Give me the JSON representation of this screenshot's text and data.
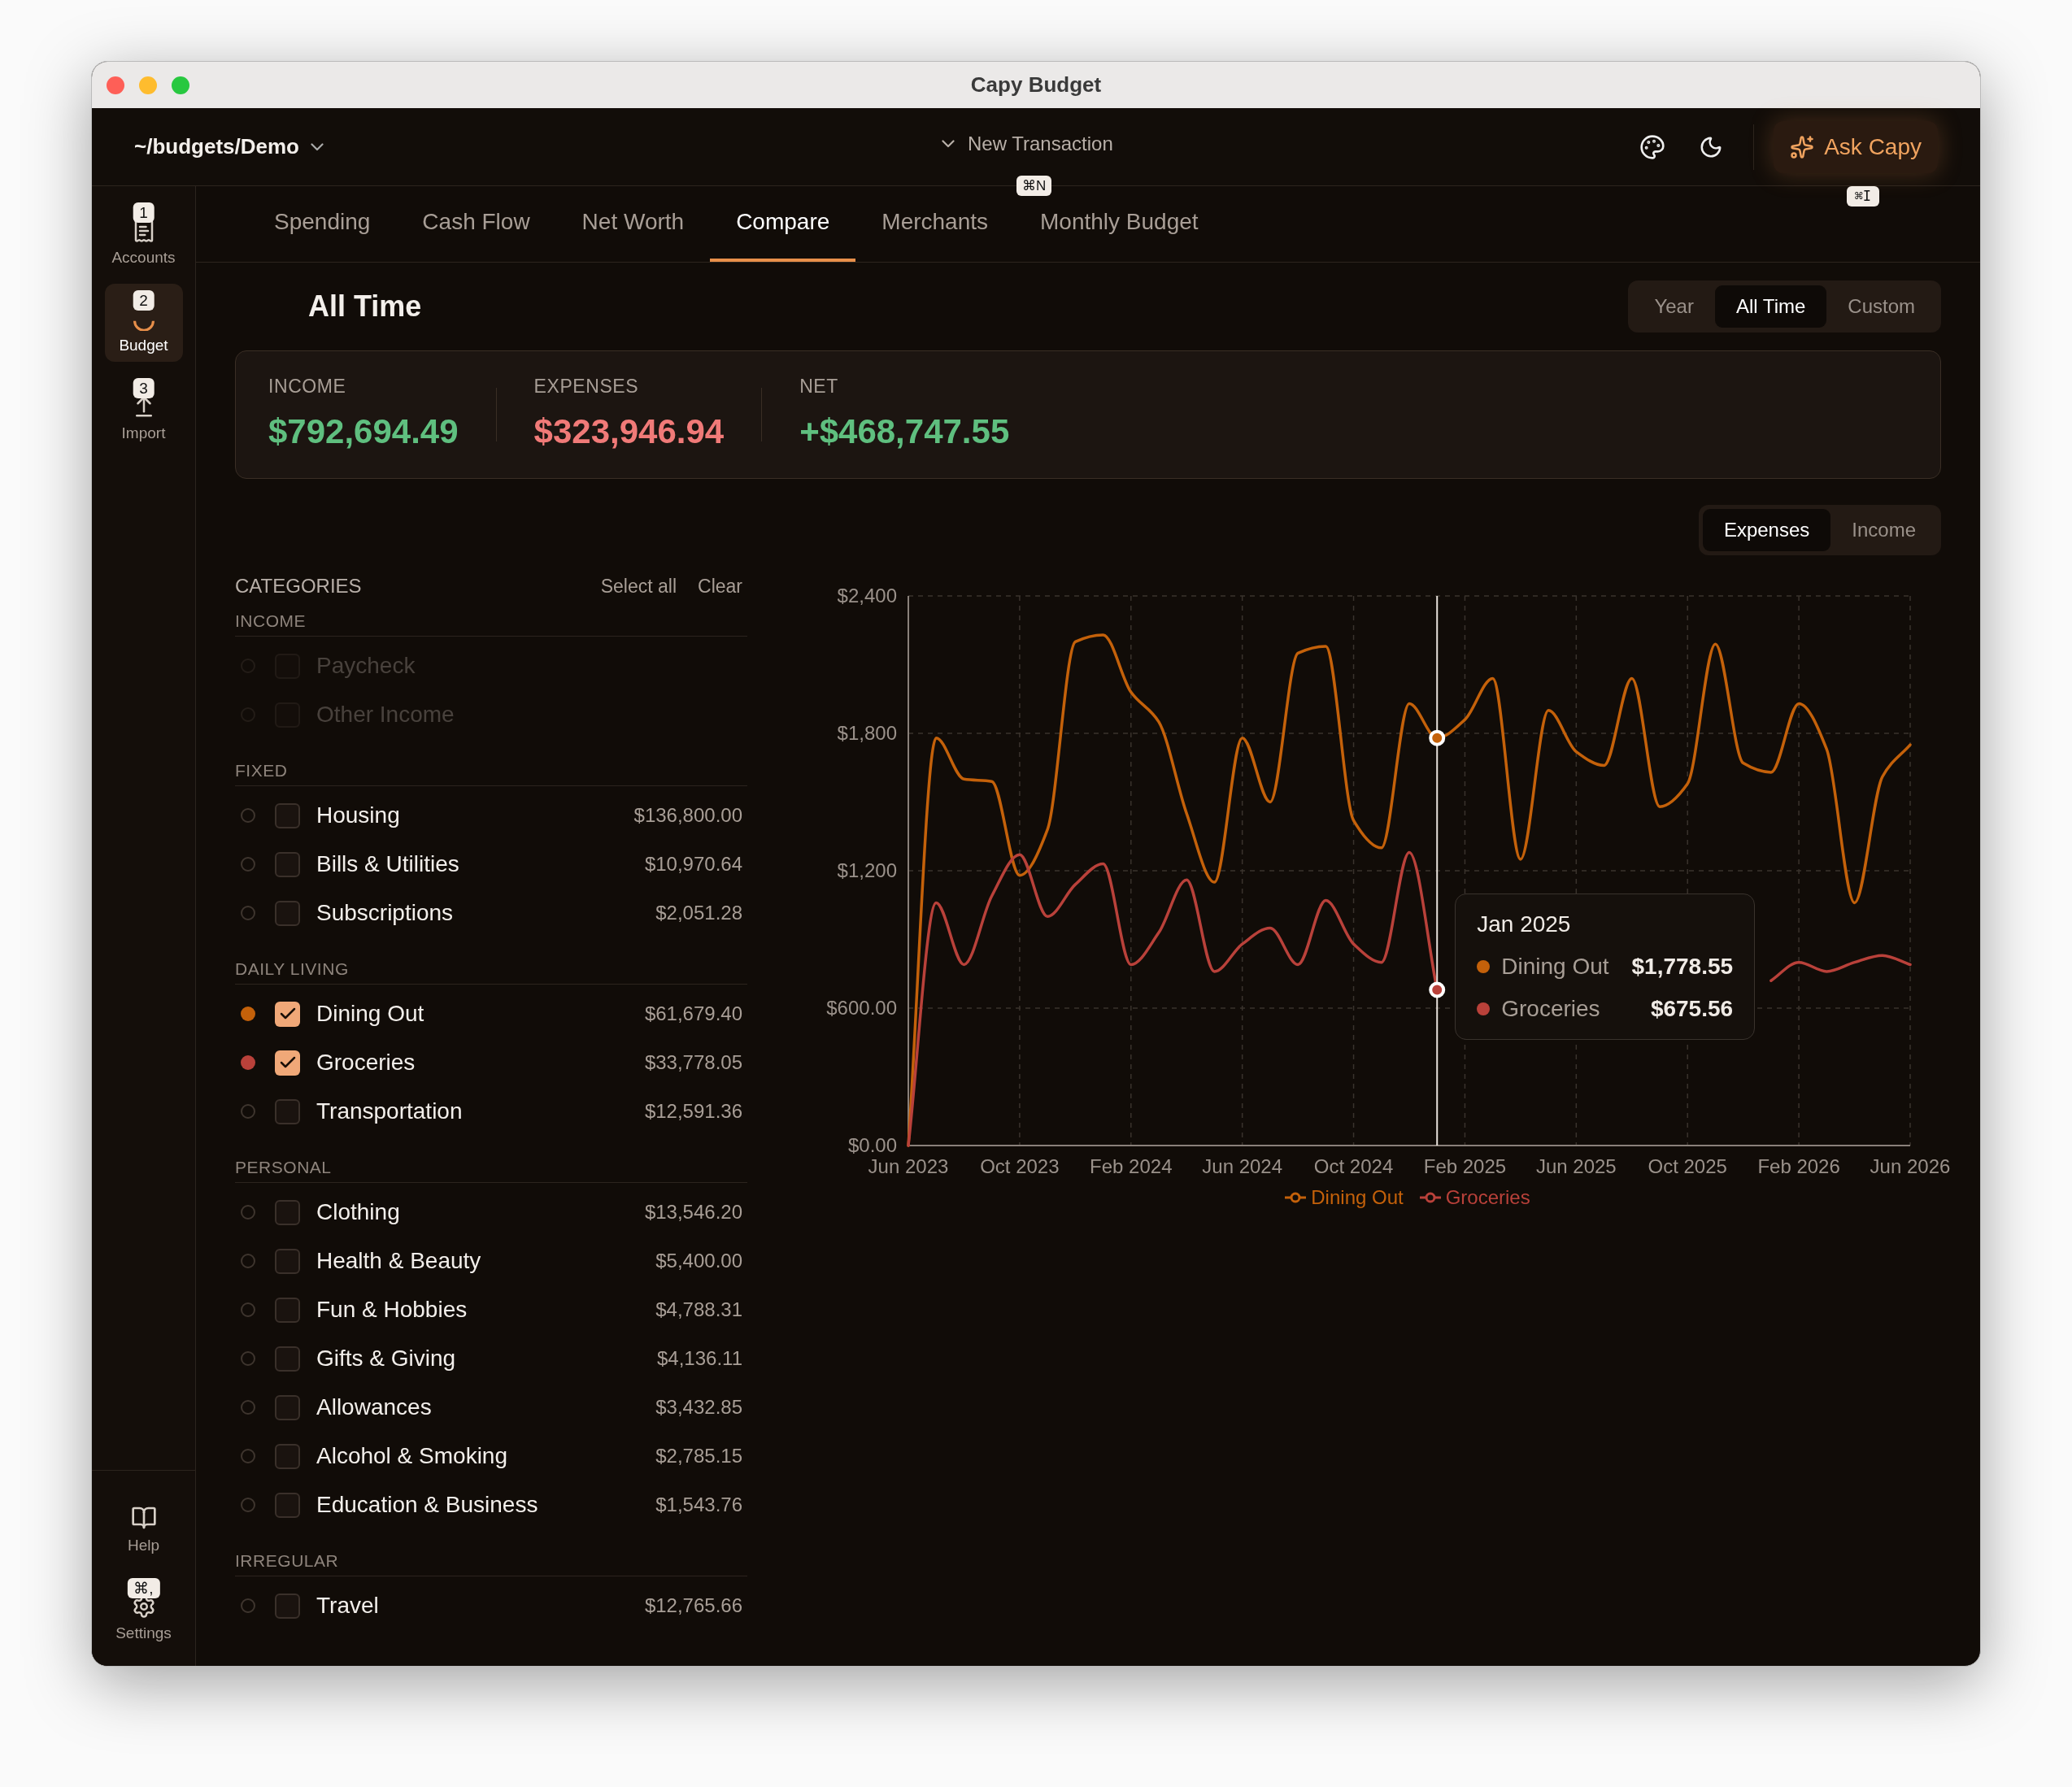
{
  "window": {
    "title": "Capy Budget"
  },
  "toolbar": {
    "path": "~/budgets/Demo",
    "new_transaction": "New Transaction",
    "new_transaction_shortcut": "⌘N",
    "ask": "Ask Capy",
    "ask_shortcut": "⌘I"
  },
  "sidebar": {
    "items": [
      {
        "label": "Accounts",
        "key": "1",
        "kind": "accounts",
        "selected": false
      },
      {
        "label": "Budget",
        "key": "2",
        "kind": "budget",
        "selected": true
      },
      {
        "label": "Import",
        "key": "3",
        "kind": "import",
        "selected": false
      }
    ],
    "bottom": [
      {
        "label": "Help",
        "kind": "help"
      },
      {
        "label": "Settings",
        "key": "⌘,",
        "kind": "settings"
      }
    ]
  },
  "tabs": [
    {
      "label": "Spending",
      "selected": false
    },
    {
      "label": "Cash Flow",
      "selected": false
    },
    {
      "label": "Net Worth",
      "selected": false
    },
    {
      "label": "Compare",
      "selected": true
    },
    {
      "label": "Merchants",
      "selected": false
    },
    {
      "label": "Monthly Budget",
      "selected": false
    }
  ],
  "period": {
    "title": "All Time",
    "options": [
      {
        "label": "Year",
        "selected": false
      },
      {
        "label": "All Time",
        "selected": true
      },
      {
        "label": "Custom",
        "selected": false
      }
    ]
  },
  "summary": [
    {
      "label": "INCOME",
      "value": "$792,694.49",
      "kind": "positive"
    },
    {
      "label": "EXPENSES",
      "value": "$323,946.94",
      "kind": "negative"
    },
    {
      "label": "NET",
      "value": "+$468,747.55",
      "kind": "positive"
    }
  ],
  "mode": [
    {
      "label": "Expenses",
      "selected": true
    },
    {
      "label": "Income",
      "selected": false
    }
  ],
  "categories": {
    "title": "CATEGORIES",
    "select_all": "Select all",
    "clear": "Clear",
    "groups": [
      {
        "title": "INCOME",
        "items": [
          {
            "name": "Paycheck",
            "checked": false,
            "disabled": true
          },
          {
            "name": "Other Income",
            "checked": false,
            "disabled": true
          }
        ]
      },
      {
        "title": "FIXED",
        "items": [
          {
            "name": "Housing",
            "amount": "$136,800.00",
            "checked": false,
            "disabled": false
          },
          {
            "name": "Bills & Utilities",
            "amount": "$10,970.64",
            "checked": false,
            "disabled": false
          },
          {
            "name": "Subscriptions",
            "amount": "$2,051.28",
            "checked": false,
            "disabled": false
          }
        ]
      },
      {
        "title": "DAILY LIVING",
        "items": [
          {
            "name": "Dining Out",
            "amount": "$61,679.40",
            "checked": true,
            "disabled": false,
            "color": "#c4610a"
          },
          {
            "name": "Groceries",
            "amount": "$33,778.05",
            "checked": true,
            "disabled": false,
            "color": "#b9413a"
          },
          {
            "name": "Transportation",
            "amount": "$12,591.36",
            "checked": false,
            "disabled": false
          }
        ]
      },
      {
        "title": "PERSONAL",
        "items": [
          {
            "name": "Clothing",
            "amount": "$13,546.20",
            "checked": false,
            "disabled": false
          },
          {
            "name": "Health & Beauty",
            "amount": "$5,400.00",
            "checked": false,
            "disabled": false
          },
          {
            "name": "Fun & Hobbies",
            "amount": "$4,788.31",
            "checked": false,
            "disabled": false
          },
          {
            "name": "Gifts & Giving",
            "amount": "$4,136.11",
            "checked": false,
            "disabled": false
          },
          {
            "name": "Allowances",
            "amount": "$3,432.85",
            "checked": false,
            "disabled": false
          },
          {
            "name": "Alcohol & Smoking",
            "amount": "$2,785.15",
            "checked": false,
            "disabled": false
          },
          {
            "name": "Education & Business",
            "amount": "$1,543.76",
            "checked": false,
            "disabled": false
          }
        ]
      },
      {
        "title": "IRREGULAR",
        "items": [
          {
            "name": "Travel",
            "amount": "$12,765.66",
            "checked": false,
            "disabled": false
          }
        ]
      }
    ]
  },
  "chart": {
    "chart_data": {
      "type": "line",
      "categories": [
        "Jun 2023",
        null,
        null,
        null,
        "Oct 2023",
        null,
        null,
        null,
        "Feb 2024",
        null,
        null,
        null,
        "Jun 2024",
        null,
        null,
        null,
        "Oct 2024",
        null,
        null,
        null,
        "Feb 2025",
        null,
        null,
        null,
        "Jun 2025",
        null,
        null,
        null,
        "Oct 2025",
        null,
        null,
        null,
        "Feb 2026",
        null,
        null,
        null,
        "Jun 2026"
      ],
      "grid": true,
      "legend": true,
      "ylim": [
        0,
        2400
      ],
      "yticks": [
        {
          "value": 0,
          "label": "$0.00"
        },
        {
          "value": 600,
          "label": "$600.00"
        },
        {
          "value": 1200,
          "label": "$1,200"
        },
        {
          "value": 1800,
          "label": "$1,800"
        },
        {
          "value": 2400,
          "label": "$2,400"
        }
      ],
      "series": [
        {
          "name": "Dining Out",
          "color": "#c4610a",
          "values": [
            0,
            1780,
            1600,
            1590,
            1180,
            1380,
            2200,
            2230,
            1980,
            1850,
            1450,
            1150,
            1780,
            1500,
            2150,
            2180,
            1420,
            1300,
            1930,
            1780,
            1860,
            2040,
            1250,
            1900,
            1720,
            1660,
            2040,
            1480,
            1580,
            2190,
            1670,
            1630,
            1930,
            1730,
            1060,
            1610,
            1750
          ]
        },
        {
          "name": "Groceries",
          "color": "#b9413a",
          "values": [
            0,
            1060,
            790,
            1090,
            1270,
            1000,
            1140,
            1230,
            790,
            930,
            1160,
            760,
            880,
            950,
            790,
            1070,
            880,
            800,
            1280,
            680,
            null,
            null,
            null,
            null,
            null,
            null,
            null,
            null,
            null,
            null,
            null,
            720,
            800,
            760,
            800,
            830,
            790
          ]
        }
      ]
    },
    "tooltip": {
      "title": "Jan 2025",
      "rows": [
        {
          "label": "Dining Out",
          "value": "$1,778.55",
          "color": "#c4610a"
        },
        {
          "label": "Groceries",
          "value": "$675.56",
          "color": "#b9413a"
        }
      ]
    }
  }
}
